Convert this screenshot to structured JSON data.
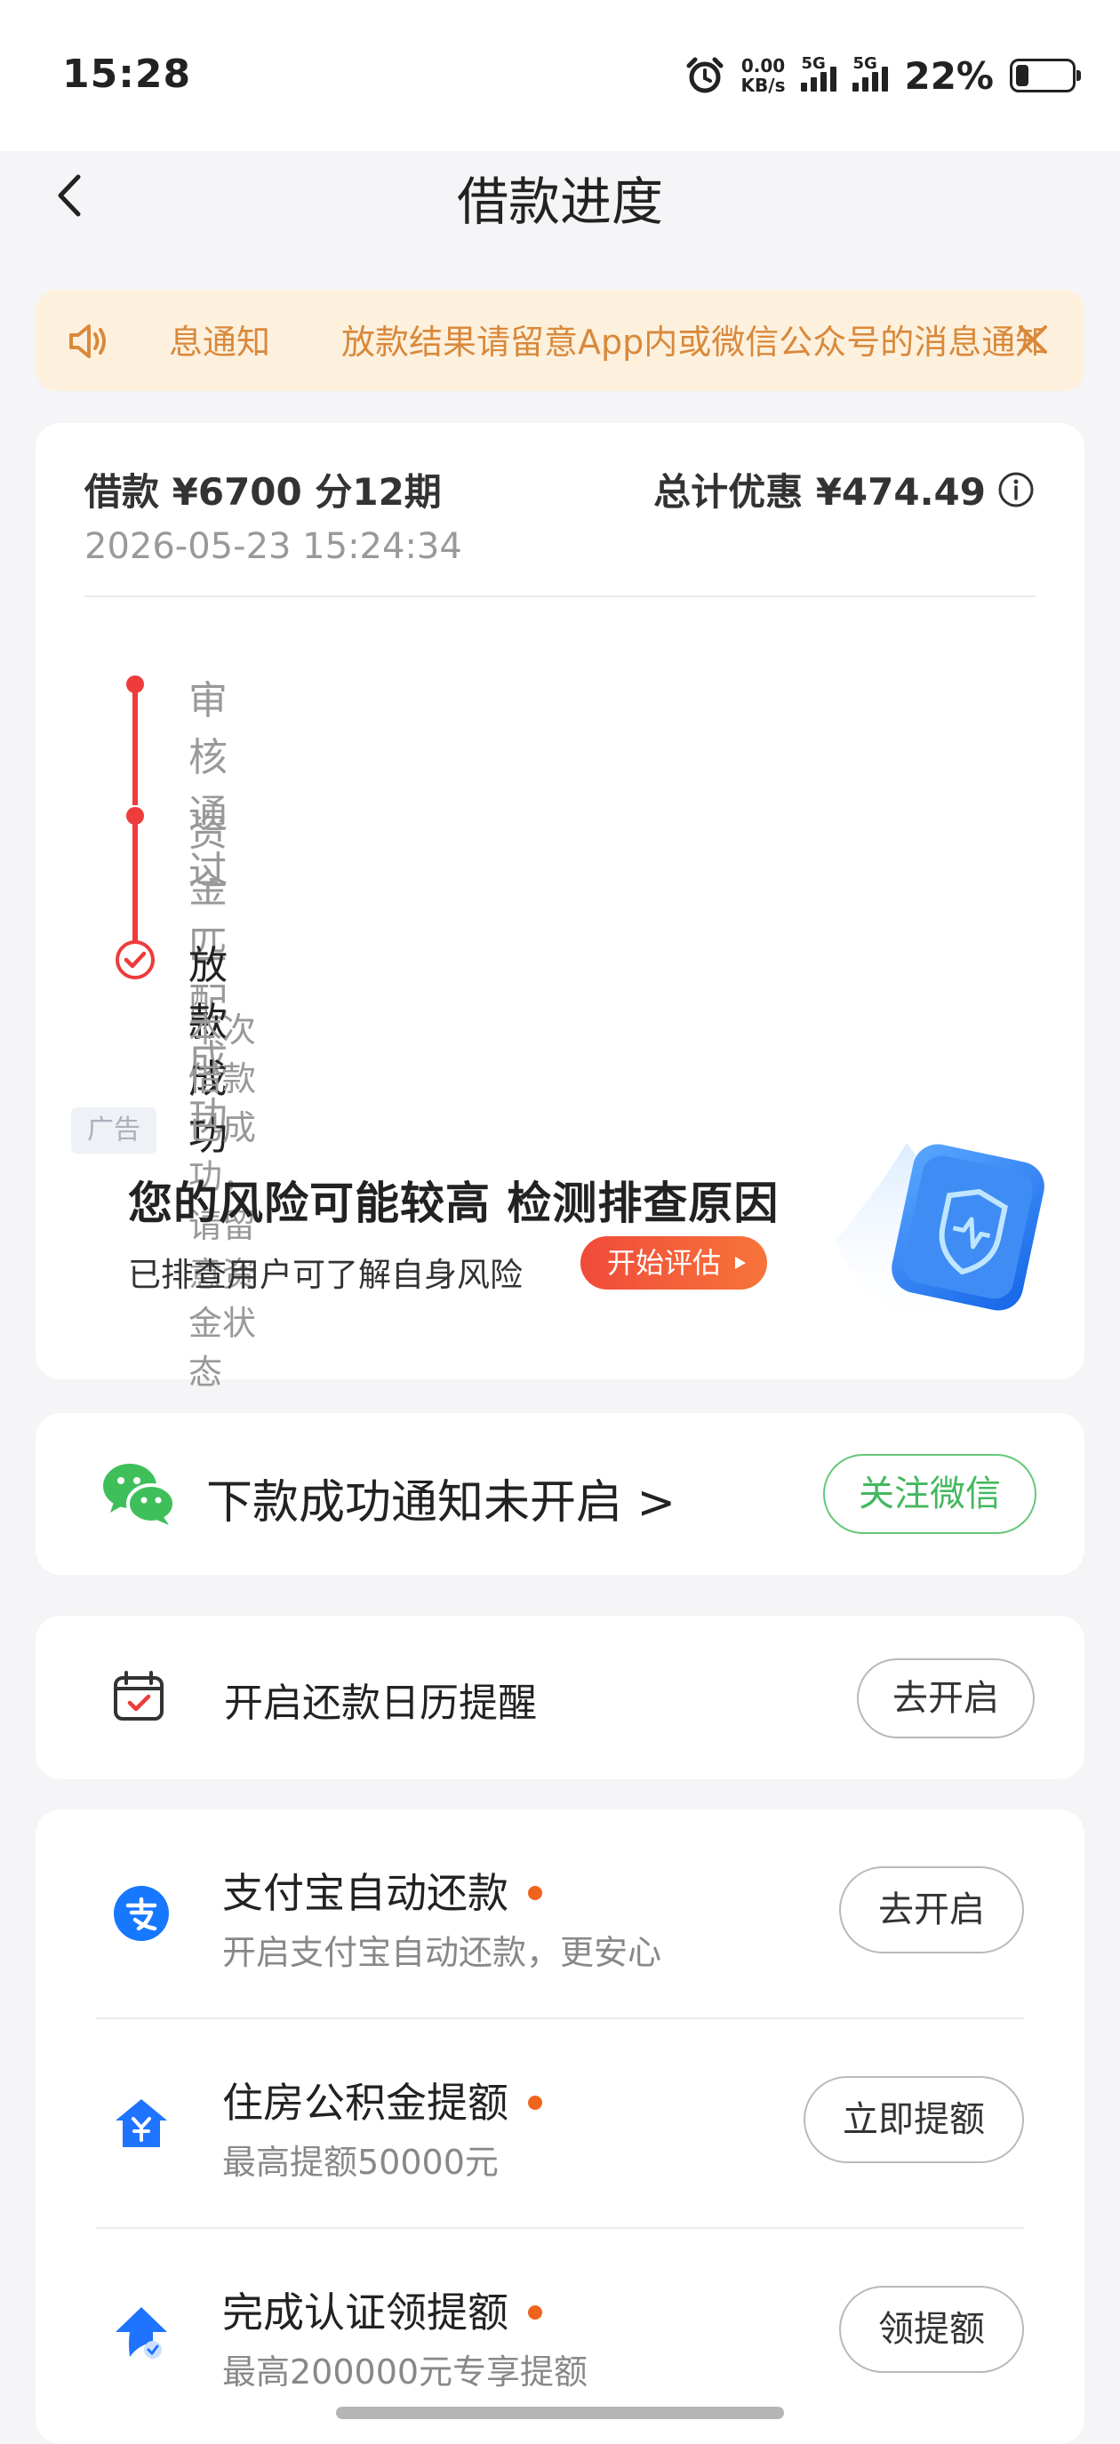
{
  "status_bar": {
    "time": "15:28",
    "net_speed_value": "0.00",
    "net_speed_unit": "KB/s",
    "signal1_tag": "5G",
    "signal2_tag": "5G",
    "battery_percent": "22%"
  },
  "nav": {
    "title": "借款进度"
  },
  "notice": {
    "label": "息通知",
    "text": "放款结果请留意App内或微信公众号的消息通知"
  },
  "loan": {
    "summary": "借款 ¥6700  分12期",
    "discount": "总计优惠 ¥474.49",
    "time": "2026-05-23 15:24:34"
  },
  "steps": [
    {
      "label": "审核通过"
    },
    {
      "label": "资金匹配成功"
    },
    {
      "label": "放款成功",
      "desc": "本次借款已成功，请留意资金状态"
    }
  ],
  "ad": {
    "tag": "广告",
    "title": "您的风险可能较高 检测排查原因",
    "subtitle": "已排查用户可了解自身风险",
    "button": "开始评估"
  },
  "wechat": {
    "text": "下款成功通知未开启 >",
    "button": "关注微信"
  },
  "calendar": {
    "text": "开启还款日历提醒",
    "button": "去开启"
  },
  "services": [
    {
      "title": "支付宝自动还款",
      "desc": "开启支付宝自动还款，更安心",
      "button": "去开启"
    },
    {
      "title": "住房公积金提额",
      "desc": "最高提额50000元",
      "button": "立即提额"
    },
    {
      "title": "完成认证领提额",
      "desc": "最高200000元专享提额",
      "button": "领提额"
    }
  ],
  "colors": {
    "accent_red": "#ee3b3b",
    "notice_bg": "#fdf1de",
    "notice_text": "#d9893b",
    "wechat_green": "#44b85f",
    "badge_orange": "#f0631d"
  }
}
